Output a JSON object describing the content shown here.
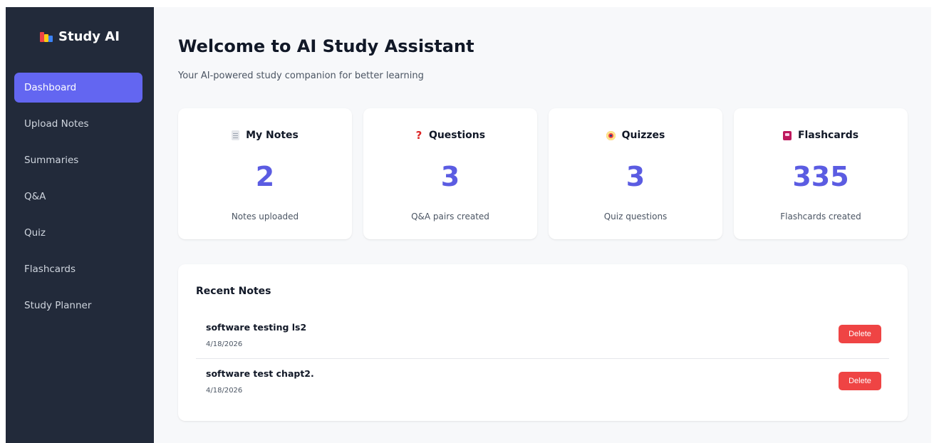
{
  "app": {
    "name": "Study AI"
  },
  "sidebar": {
    "items": [
      {
        "label": "Dashboard",
        "active": true
      },
      {
        "label": "Upload Notes"
      },
      {
        "label": "Summaries"
      },
      {
        "label": "Q&A"
      },
      {
        "label": "Quiz"
      },
      {
        "label": "Flashcards"
      },
      {
        "label": "Study Planner"
      }
    ]
  },
  "main": {
    "title": "Welcome to AI Study Assistant",
    "subtitle": "Your AI-powered study companion for better learning",
    "stats": [
      {
        "icon": "document-icon",
        "title": "My Notes",
        "value": "2",
        "label": "Notes uploaded"
      },
      {
        "icon": "question-icon",
        "title": "Questions",
        "value": "3",
        "label": "Q&A pairs created"
      },
      {
        "icon": "target-icon",
        "title": "Quizzes",
        "value": "3",
        "label": "Quiz questions"
      },
      {
        "icon": "flashcard-icon",
        "title": "Flashcards",
        "value": "335",
        "label": "Flashcards created"
      }
    ],
    "recent": {
      "title": "Recent Notes",
      "notes": [
        {
          "title": "software testing ls2",
          "date": "4/18/2026",
          "action": "Delete"
        },
        {
          "title": "software test chapt2.",
          "date": "4/18/2026",
          "action": "Delete"
        }
      ]
    }
  },
  "colors": {
    "sidebar": "#222a3a",
    "accent": "#6366f1",
    "value": "#5b5ce2",
    "danger": "#ef4444"
  }
}
